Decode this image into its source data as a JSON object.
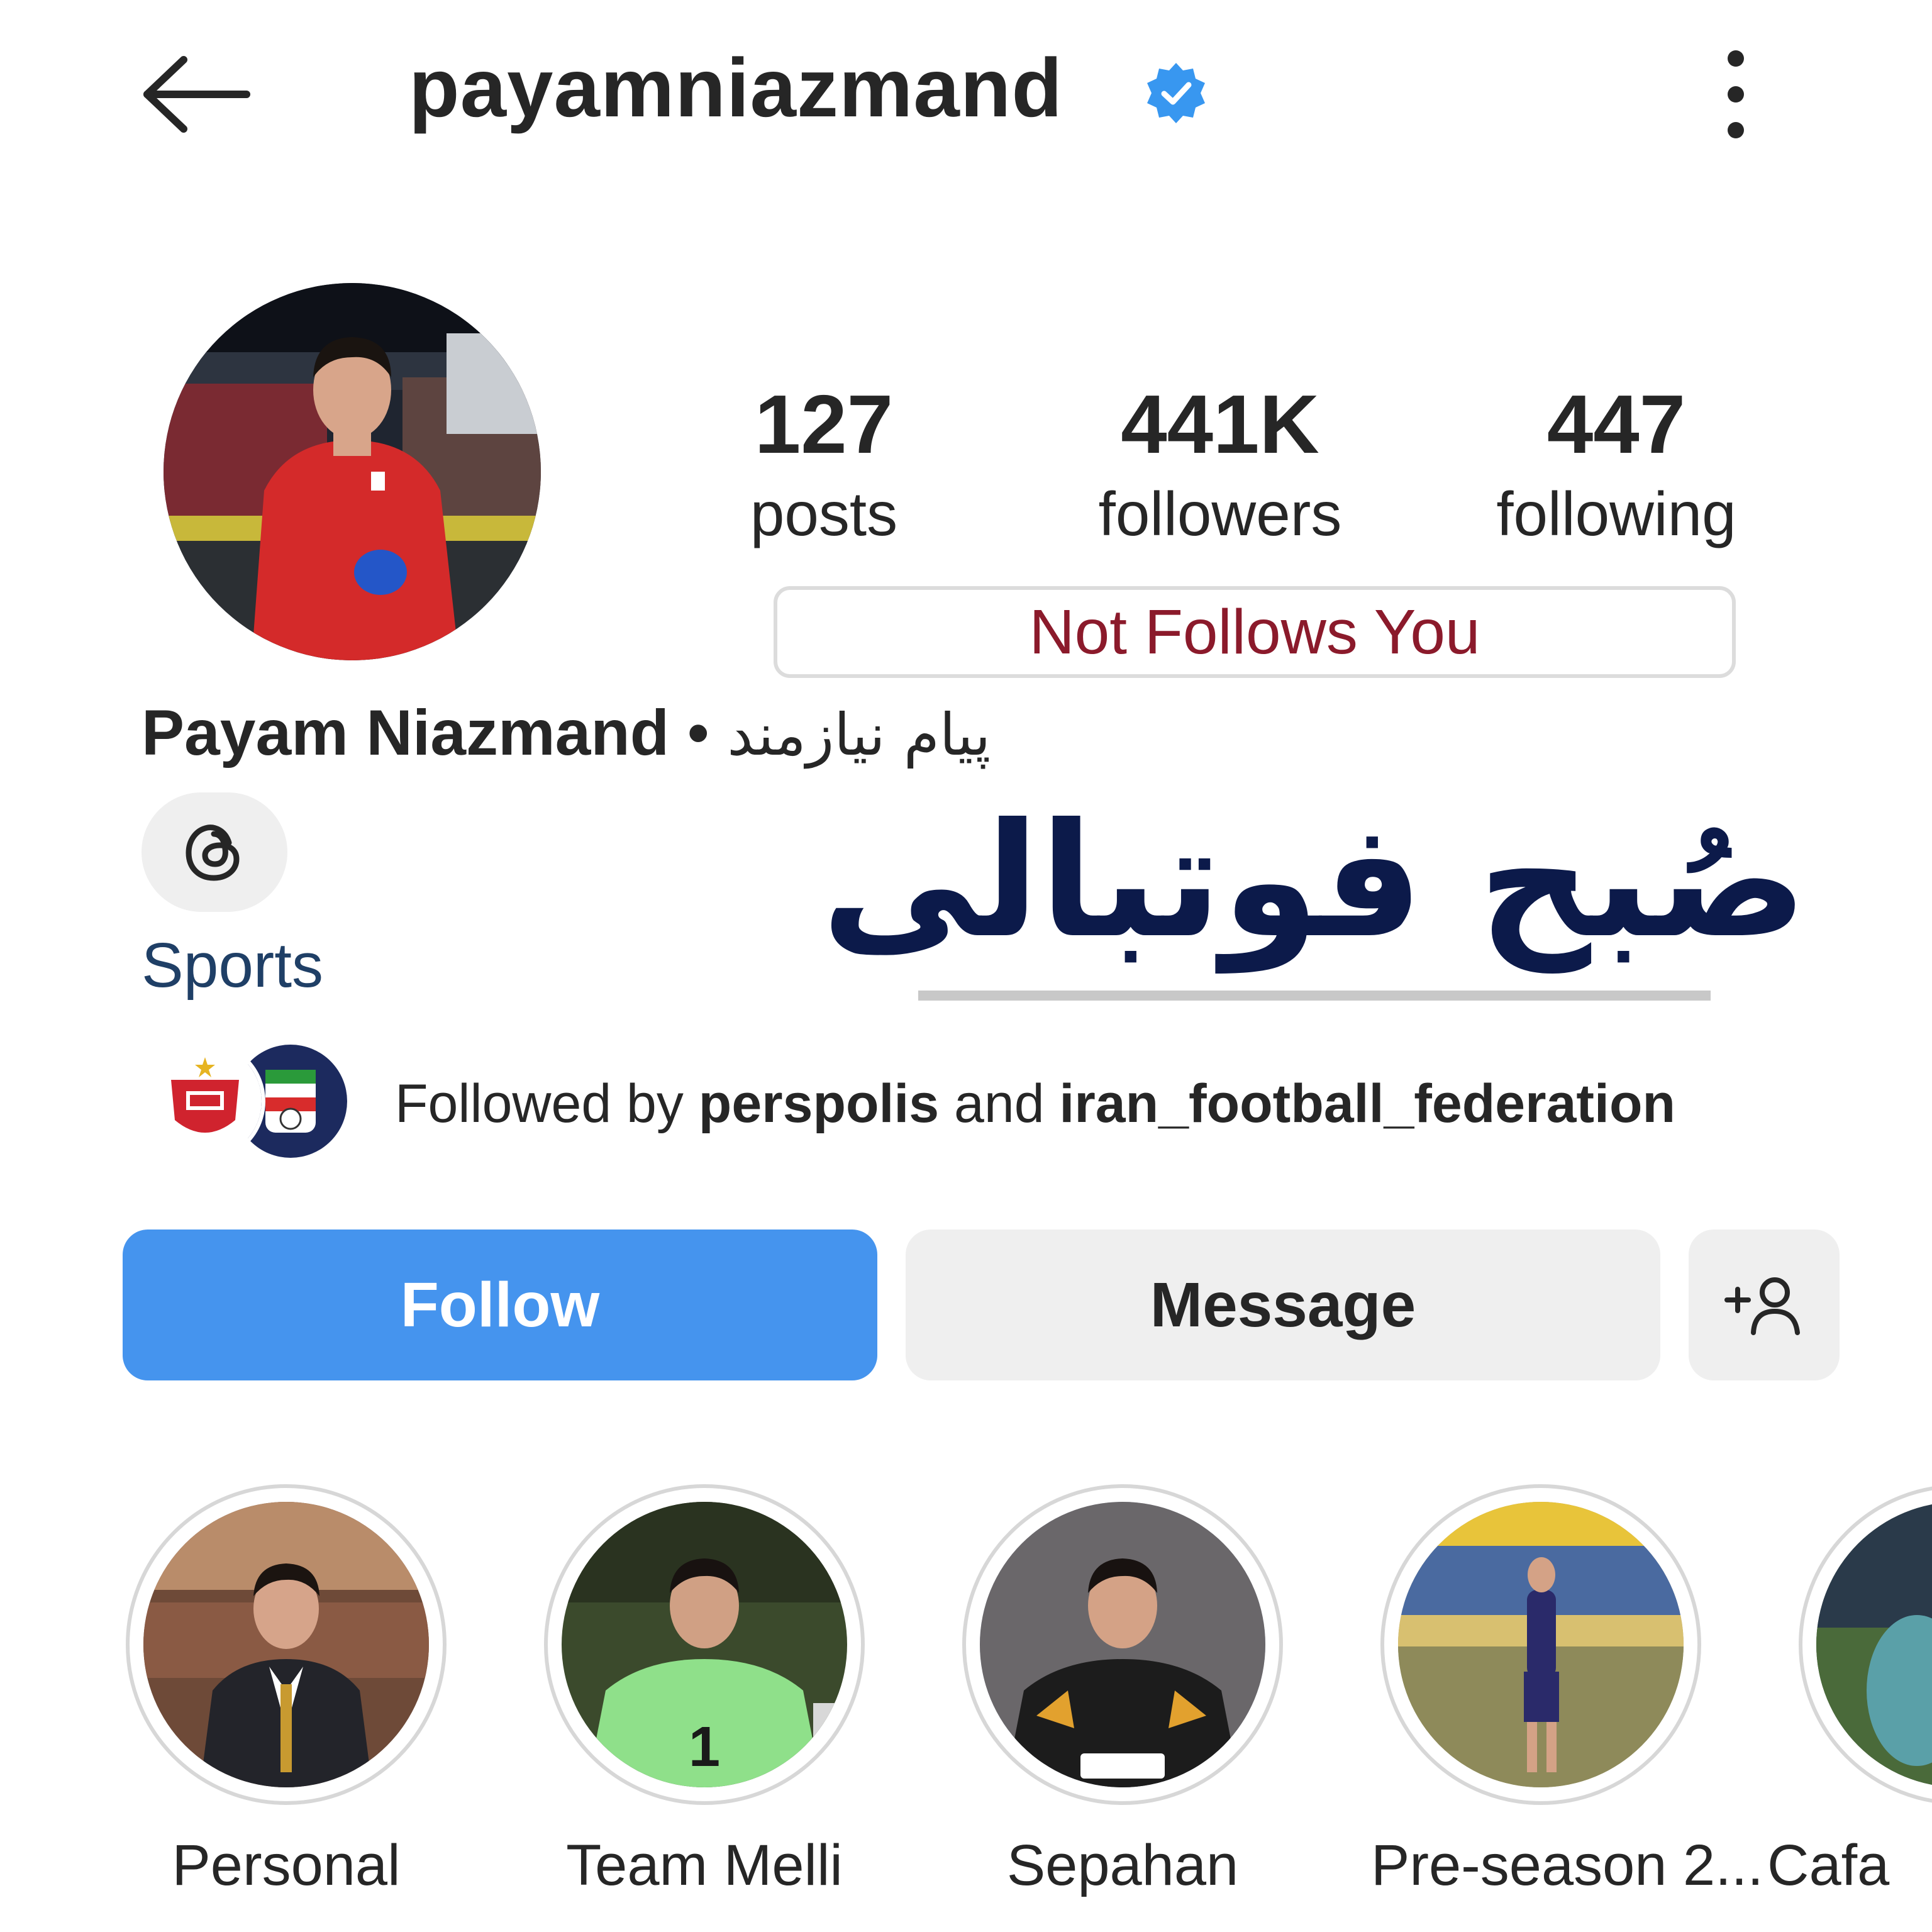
{
  "header": {
    "username": "payamniazmand",
    "verified_icon": "verified-badge-icon",
    "back_icon": "back-arrow-icon",
    "more_icon": "more-vertical-icon"
  },
  "profile": {
    "full_name": "Payam Niazmand",
    "separator": "•",
    "full_name_fa": "پیام نیازمند",
    "category": "Sports",
    "threads_icon": "threads-icon",
    "relationship_badge": "Not Follows You"
  },
  "stats": [
    {
      "value": "127",
      "label": "posts"
    },
    {
      "value": "441K",
      "label": "followers"
    },
    {
      "value": "447",
      "label": "following"
    }
  ],
  "watermark": {
    "text": "صُبح فوتبالی",
    "color": "#0c1a4a"
  },
  "followed_by": {
    "prefix": "Followed by ",
    "user1": "perspolis",
    "conjunction": " and ",
    "user2": "iran_football_federation"
  },
  "actions": {
    "follow_label": "Follow",
    "message_label": "Message",
    "add_user_icon": "add-user-icon"
  },
  "highlights": [
    {
      "label": "Personal"
    },
    {
      "label": "Team Melli"
    },
    {
      "label": "Sepahan"
    },
    {
      "label": "Pre-season 2..."
    },
    {
      "label": "Cafa"
    }
  ],
  "colors": {
    "follow_button": "#4594ee",
    "secondary_button": "#efefef",
    "badge_text": "#8b1a2b",
    "category_text": "#1f3f66",
    "verified": "#3897f0"
  }
}
